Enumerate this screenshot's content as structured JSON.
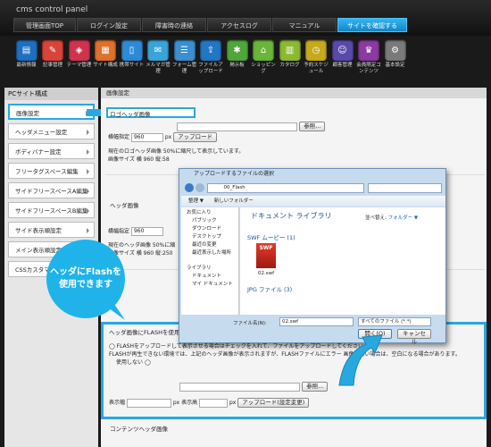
{
  "app_title": "cms control panel",
  "nav": [
    {
      "label": "管理画面TOP"
    },
    {
      "label": "ログイン設定"
    },
    {
      "label": "障害時の連絡"
    },
    {
      "label": "アクセスログ"
    },
    {
      "label": "マニュアル"
    },
    {
      "label": "サイトを確認する"
    }
  ],
  "tools": [
    {
      "label": "最新情報",
      "icon": "news-icon",
      "color": "#1e6fc0"
    },
    {
      "label": "記事管理",
      "icon": "article-icon",
      "color": "#d8443a"
    },
    {
      "label": "テーマ管理",
      "icon": "theme-icon",
      "color": "#d0334c"
    },
    {
      "label": "サイト構成",
      "icon": "site-structure-icon",
      "color": "#e0702a"
    },
    {
      "label": "携帯サイト",
      "icon": "mobile-site-icon",
      "color": "#2f8ad6"
    },
    {
      "label": "メルマガ管理",
      "icon": "newsletter-icon",
      "color": "#3aa4d8"
    },
    {
      "label": "フォーム管理",
      "icon": "form-icon",
      "color": "#3b8fd0"
    },
    {
      "label": "ファイルアップロード",
      "icon": "file-upload-icon",
      "color": "#2376c4"
    },
    {
      "label": "掲示板",
      "icon": "bbs-icon",
      "color": "#4fa63a"
    },
    {
      "label": "ショッピング",
      "icon": "shopping-icon",
      "color": "#6ab53a"
    },
    {
      "label": "カタログ",
      "icon": "catalog-icon",
      "color": "#8cb832"
    },
    {
      "label": "予約スケジュール",
      "icon": "schedule-icon",
      "color": "#c7a91e"
    },
    {
      "label": "顧客管理",
      "icon": "customer-icon",
      "color": "#5a4aa8"
    },
    {
      "label": "会員限定コンテンツ",
      "icon": "members-icon",
      "color": "#8a3aa0"
    },
    {
      "label": "基本設定",
      "icon": "settings-icon",
      "color": "#7a7a7a"
    }
  ],
  "sidebar": {
    "heading": "PCサイト構成",
    "items": [
      {
        "label": "画像設定"
      },
      {
        "label": "ヘッダメニュー設定"
      },
      {
        "label": "ボディバナー設定"
      },
      {
        "label": "フリータグスペース編集"
      },
      {
        "label": "サイドフリースペースA編集"
      },
      {
        "label": "サイドフリースペースB編集"
      },
      {
        "label": "サイド表示順設定"
      },
      {
        "label": "メイン表示順設定"
      },
      {
        "label": "CSSカスタマイズ"
      }
    ]
  },
  "main": {
    "heading": "画像設定",
    "logo": {
      "title": "ロゴヘッダ画像",
      "browse": "参照...",
      "width_label": "横幅指定",
      "width_value": "960",
      "px": "px",
      "upload": "アップロード",
      "line1": "現在のロゴヘッダ画像 50%に縮尺して表示しています。",
      "line2": "画像サイズ 横 960 縦:58"
    },
    "header": {
      "title": "ヘッダ画像",
      "width_label": "横幅指定",
      "width_value": "960",
      "line1": "現在のヘッダ画像 50%に縮",
      "line2": "画像サイズ 横 960 縦:250"
    },
    "flash": {
      "title": "ヘッダ画像にFLASHを使用する",
      "line1": "FLASHをアップロードして表示させる場合はチェックを入れて、ファイルをアップロードしてください。",
      "line2": "FLASHが再生できない環境では、上記のヘッダ画像が表示されますが、FLASHファイルにエラー",
      "line2b": "画像が無い場合は、空白になる場合があります。",
      "unused": "使用しない",
      "browse": "参照...",
      "w_label": "表示幅",
      "h_label": "px 表示高",
      "px": "px",
      "upload": "アップロード(設定変更)"
    },
    "contents_header": "コンテンツヘッダ画像"
  },
  "dialog": {
    "title": "アップロードするファイルの選択",
    "path": "00_Flash",
    "search_placeholder": "",
    "toolbar_org": "整理 ▼",
    "toolbar_new": "新しいフォルダー",
    "tree": [
      "お気に入り",
      "パブリック",
      "ダウンロード",
      "デスクトップ",
      "最近の変更",
      "最近表示した場所",
      "ライブラリ",
      "ドキュメント",
      "マイ ドキュメント"
    ],
    "library_title": "ドキュメント ライブラリ",
    "sort_label": "並べ替え:",
    "sort_value": "フォルダー ▼",
    "group1": "SWF ムービー (1)",
    "file_badge": "SWF",
    "file_name": "02.swf",
    "group2": "JPG ファイル (3)",
    "filename_label": "ファイル名(N):",
    "filename_value": "02.swf",
    "filetype": "すべてのファイル (*.*)",
    "open": "開く(O)",
    "cancel": "キャンセル"
  },
  "callout": "ヘッダにFlashを使用できます",
  "colors": {
    "accent": "#29a8e0",
    "callout": "#1fb3ea"
  }
}
